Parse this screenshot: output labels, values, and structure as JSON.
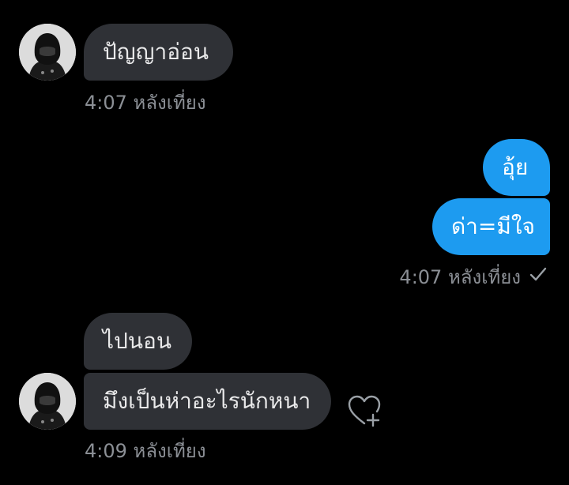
{
  "conversation": {
    "group1": {
      "avatar_icon": "profile-avatar-icon",
      "message": "ปัญญาอ่อน",
      "timestamp": "4:07 หลังเที่ยง"
    },
    "group2": {
      "messages": [
        "อุ้ย",
        "ด่า=มีใจ"
      ],
      "timestamp": "4:07 หลังเที่ยง",
      "status_icon": "sent-check-icon"
    },
    "group3": {
      "avatar_icon": "profile-avatar-icon",
      "messages": [
        "ไปนอน",
        "มึงเป็นห่าอะไรนักหนา"
      ],
      "timestamp": "4:09 หลังเที่ยง",
      "reaction_icon": "heart-plus-icon"
    }
  },
  "colors": {
    "background": "#000000",
    "incoming_bubble": "#2f3136",
    "outgoing_bubble": "#1d9bf0",
    "timestamp_text": "#8b8f95"
  }
}
